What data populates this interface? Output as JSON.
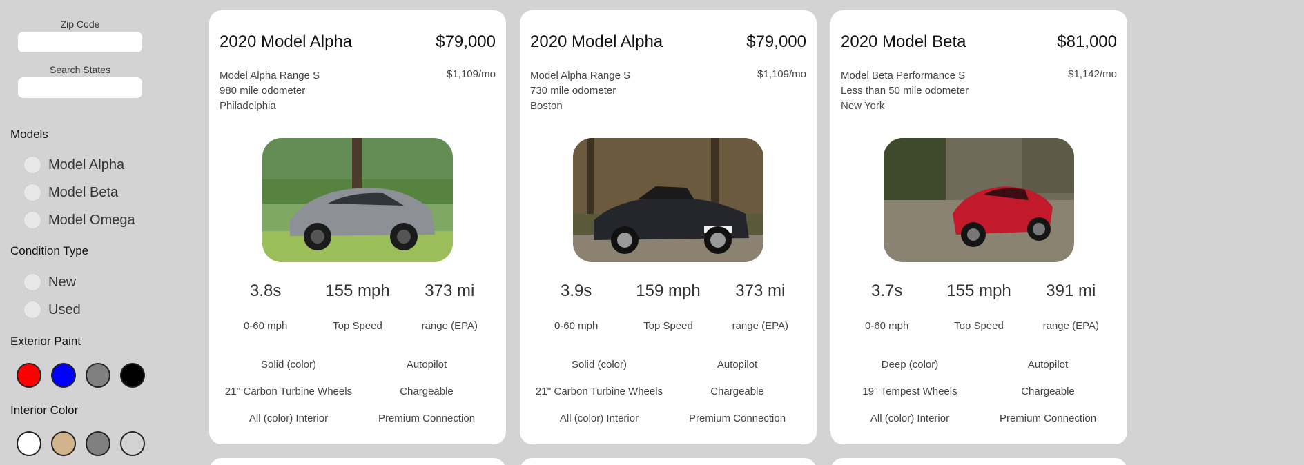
{
  "sidebar": {
    "zip": {
      "label": "Zip Code",
      "value": "",
      "placeholder": ""
    },
    "states": {
      "label": "Search States",
      "value": "",
      "placeholder": ""
    },
    "models_title": "Models",
    "models": [
      "Model Alpha",
      "Model Beta",
      "Model Omega"
    ],
    "condition_title": "Condition Type",
    "conditions": [
      "New",
      "Used"
    ],
    "exterior_title": "Exterior Paint",
    "exterior_colors": [
      "#ff0000",
      "#0000ff",
      "#808080",
      "#000000"
    ],
    "interior_title": "Interior Color",
    "interior_colors": [
      "#ffffff",
      "#d2b48c",
      "#808080",
      "#d3d3d3"
    ]
  },
  "cards": [
    {
      "title": "2020 Model Alpha",
      "price": "$79,000",
      "trim": "Model Alpha Range S",
      "odometer": "980 mile odometer",
      "city": "Philadelphia",
      "monthly": "$1,109/mo",
      "photo": "silver-coupe",
      "stats": [
        {
          "value": "3.8s",
          "label": "0-60 mph"
        },
        {
          "value": "155 mph",
          "label": "Top Speed"
        },
        {
          "value": "373 mi",
          "label": "range (EPA)"
        }
      ],
      "features": [
        "Solid (color)",
        "Autopilot",
        "21'' Carbon Turbine Wheels",
        "Chargeable",
        "All (color) Interior",
        "Premium Connection"
      ]
    },
    {
      "title": "2020 Model Alpha",
      "price": "$79,000",
      "trim": "Model Alpha Range S",
      "odometer": "730 mile odometer",
      "city": "Boston",
      "monthly": "$1,109/mo",
      "photo": "black-convertible",
      "stats": [
        {
          "value": "3.9s",
          "label": "0-60 mph"
        },
        {
          "value": "159 mph",
          "label": "Top Speed"
        },
        {
          "value": "373 mi",
          "label": "range (EPA)"
        }
      ],
      "features": [
        "Solid (color)",
        "Autopilot",
        "21'' Carbon Turbine Wheels",
        "Chargeable",
        "All (color) Interior",
        "Premium Connection"
      ]
    },
    {
      "title": "2020 Model Beta",
      "price": "$81,000",
      "trim": "Model Beta Performance S",
      "odometer": "Less than 50 mile odometer",
      "city": "New York",
      "monthly": "$1,142/mo",
      "photo": "red-sports-car",
      "stats": [
        {
          "value": "3.7s",
          "label": "0-60 mph"
        },
        {
          "value": "155 mph",
          "label": "Top Speed"
        },
        {
          "value": "391 mi",
          "label": "range (EPA)"
        }
      ],
      "features": [
        "Deep (color)",
        "Autopilot",
        "19'' Tempest Wheels",
        "Chargeable",
        "All (color) Interior",
        "Premium Connection"
      ]
    }
  ]
}
